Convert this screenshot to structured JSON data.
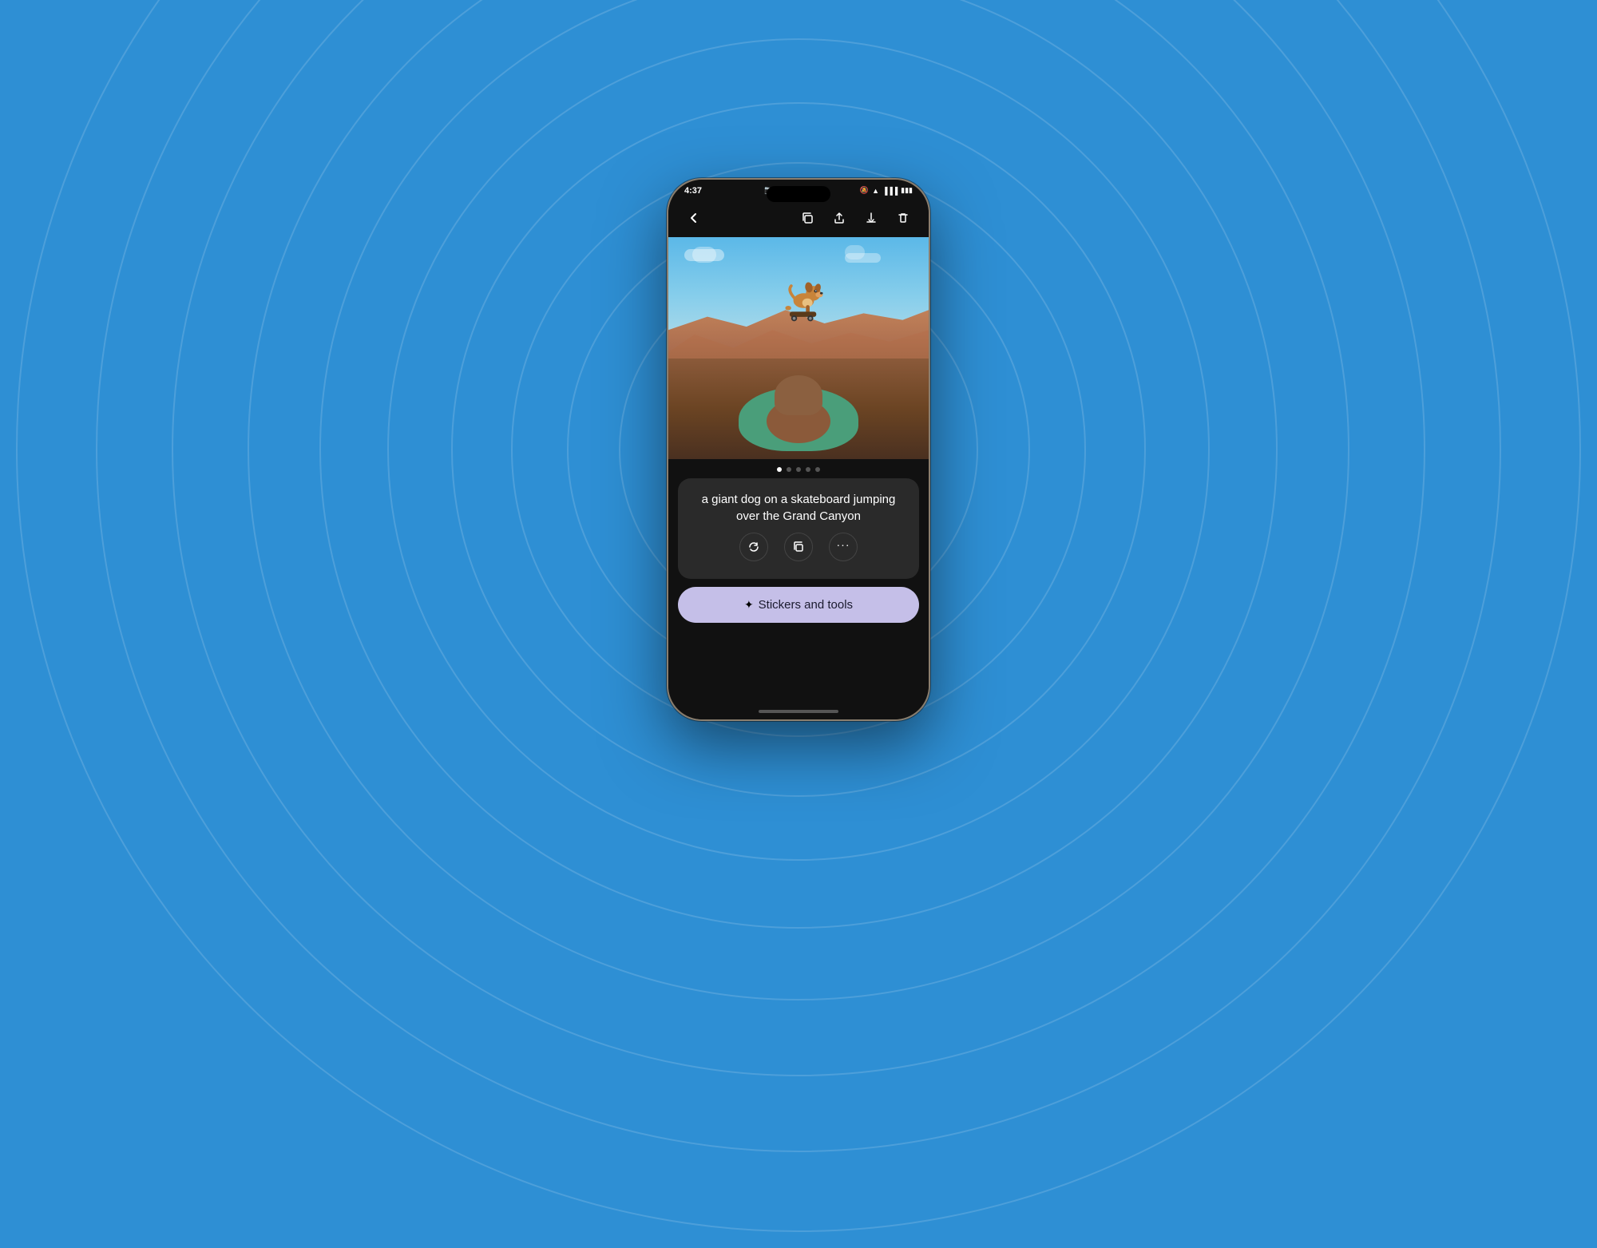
{
  "background": {
    "color": "#2e8fd4"
  },
  "status_bar": {
    "time": "4:37",
    "icons": [
      "camera-icon",
      "clock-icon",
      "facebook-icon",
      "dot-icon"
    ],
    "right_icons": [
      "mute-icon",
      "wifi-icon",
      "signal-icon",
      "battery-icon"
    ]
  },
  "nav_bar": {
    "back_label": "←",
    "icons": [
      "copy-icon",
      "share-icon",
      "download-icon",
      "delete-icon"
    ]
  },
  "image": {
    "alt": "A giant dog on a skateboard jumping over the Grand Canyon",
    "description": "AI generated image of dog on skateboard over canyon"
  },
  "dot_indicators": {
    "count": 5,
    "active_index": 0
  },
  "prompt": {
    "text": "a giant dog on a skateboard jumping over the Grand Canyon"
  },
  "action_buttons": {
    "refresh_label": "↺",
    "copy_label": "⧉",
    "more_label": "···"
  },
  "stickers_button": {
    "icon": "✦",
    "label": "Stickers and tools"
  },
  "accent_color": "#c5bfe8"
}
